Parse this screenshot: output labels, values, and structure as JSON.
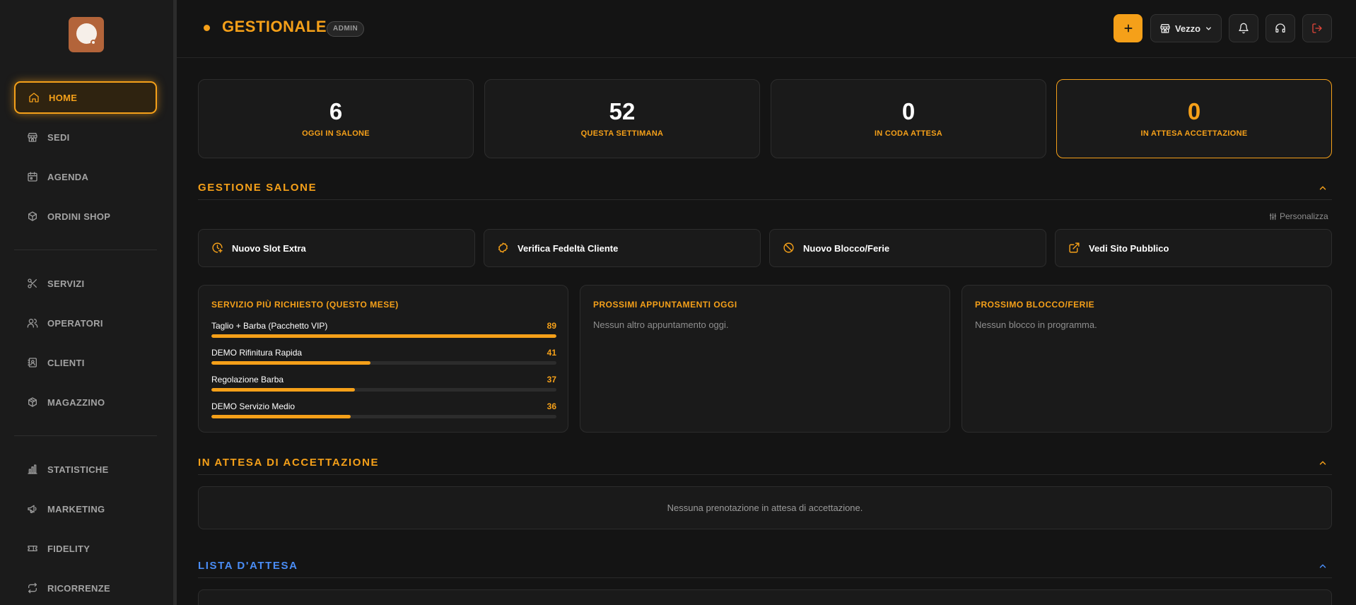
{
  "sidebar": {
    "items": [
      {
        "label": "HOME",
        "icon": "home-icon",
        "active": true
      },
      {
        "label": "SEDI",
        "icon": "store-icon"
      },
      {
        "label": "AGENDA",
        "icon": "calendar-icon"
      },
      {
        "label": "ORDINI SHOP",
        "icon": "package-icon"
      },
      {
        "label": "SERVIZI",
        "icon": "scissors-icon"
      },
      {
        "label": "OPERATORI",
        "icon": "users-icon"
      },
      {
        "label": "CLIENTI",
        "icon": "contact-icon"
      },
      {
        "label": "MAGAZZINO",
        "icon": "box-icon"
      },
      {
        "label": "STATISTICHE",
        "icon": "bar-chart-icon"
      },
      {
        "label": "MARKETING",
        "icon": "megaphone-icon"
      },
      {
        "label": "FIDELITY",
        "icon": "ticket-icon"
      },
      {
        "label": "RICORRENZE",
        "icon": "repeat-icon"
      }
    ]
  },
  "header": {
    "title": "GESTIONALE",
    "role": "ADMIN",
    "location": "Vezzo",
    "accent": "#f5a019"
  },
  "stats": [
    {
      "value": "6",
      "label": "OGGI IN SALONE"
    },
    {
      "value": "52",
      "label": "QUESTA SETTIMANA"
    },
    {
      "value": "0",
      "label": "IN CODA ATTESA"
    },
    {
      "value": "0",
      "label": "IN ATTESA ACCETTAZIONE"
    }
  ],
  "gestione": {
    "title": "GESTIONE SALONE",
    "customize": "Personalizza",
    "actions": [
      {
        "label": "Nuovo Slot Extra",
        "icon": "clock-plus-icon"
      },
      {
        "label": "Verifica Fedeltà Cliente",
        "icon": "badge-icon"
      },
      {
        "label": "Nuovo Blocco/Ferie",
        "icon": "ban-icon"
      },
      {
        "label": "Vedi Sito Pubblico",
        "icon": "external-link-icon"
      }
    ]
  },
  "top_services": {
    "title": "SERVIZIO PIÙ RICHIESTO (QUESTO MESE)",
    "max": 89,
    "items": [
      {
        "name": "Taglio + Barba (Pacchetto VIP)",
        "count": 89
      },
      {
        "name": "DEMO Rifinitura Rapida",
        "count": 41
      },
      {
        "name": "Regolazione Barba",
        "count": 37
      },
      {
        "name": "DEMO Servizio Medio",
        "count": 36
      }
    ]
  },
  "next_appointments": {
    "title": "PROSSIMI APPUNTAMENTI OGGI",
    "empty": "Nessun altro appuntamento oggi."
  },
  "next_block": {
    "title": "PROSSIMO BLOCCO/FERIE",
    "empty": "Nessun blocco in programma."
  },
  "pending": {
    "title": "IN ATTESA DI ACCETTAZIONE",
    "empty": "Nessuna prenotazione in attesa di accettazione."
  },
  "waitlist": {
    "title": "LISTA D'ATTESA",
    "color": "#4a8df6"
  }
}
